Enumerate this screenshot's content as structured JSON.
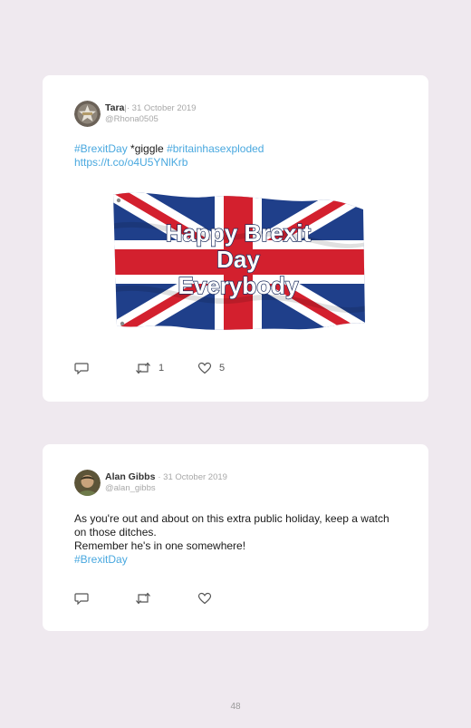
{
  "tweets": [
    {
      "name": "Tara",
      "name_suffix": "|",
      "date": "· 31 October 2019",
      "handle": "@Rhona0505",
      "tag1": "#BrexitDay",
      "text1": " *giggle ",
      "tag2": "#britainhasexploded",
      "link": "https://t.co/o4U5YNlKrb",
      "image_text": [
        "Happy Brexit",
        "Day",
        "Everybody"
      ],
      "retweets": "1",
      "likes": "5"
    },
    {
      "name": "Alan Gibbs",
      "date": "· 31 October 2019",
      "handle": "@alan_gibbs",
      "line1": "As you're out and about on this extra public holiday, keep a watch on those ditches.",
      "line2": "Remember he's in one somewhere!",
      "tag": "#BrexitDay"
    }
  ],
  "page_number": "48",
  "colors": {
    "background": "#efe9ef",
    "link": "#49a8df",
    "meta": "#a8a8a8"
  },
  "icons": [
    "reply-icon",
    "retweet-icon",
    "like-icon"
  ]
}
